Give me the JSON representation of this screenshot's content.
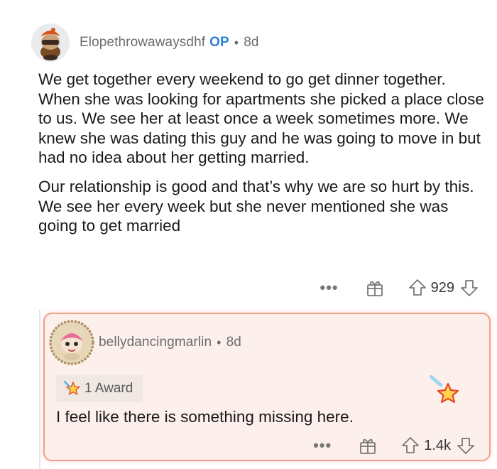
{
  "comment1": {
    "username": "Elopethrowawaysdhf",
    "op_badge": "OP",
    "separator": "•",
    "time": "8d",
    "paragraphs": [
      "We get together every weekend to go get dinner together. When she was looking for apartments she picked a place close to us. We see her at least once a week sometimes more. We knew she was dating this guy and he was going to move in but had no idea about her getting married.",
      "Our relationship is good and that’s why we are so hurt by this. We see her every week but she never mentioned she was going to get married"
    ],
    "actions": {
      "more": "•••",
      "votes": "929"
    }
  },
  "comment2": {
    "username": "bellydancingmarlin",
    "separator": "•",
    "time": "8d",
    "award_label": "1 Award",
    "text": "I feel like there is something missing here.",
    "actions": {
      "more": "•••",
      "votes": "1.4k"
    }
  },
  "icons": [
    "avatar-snoo-icon",
    "gift-icon",
    "upvote-icon",
    "downvote-icon",
    "award-icon",
    "award-star-icon"
  ],
  "colors": {
    "op": "#2f7ed8",
    "highlight_border": "#f2a08d",
    "highlight_bg": "#fdf0ec"
  }
}
